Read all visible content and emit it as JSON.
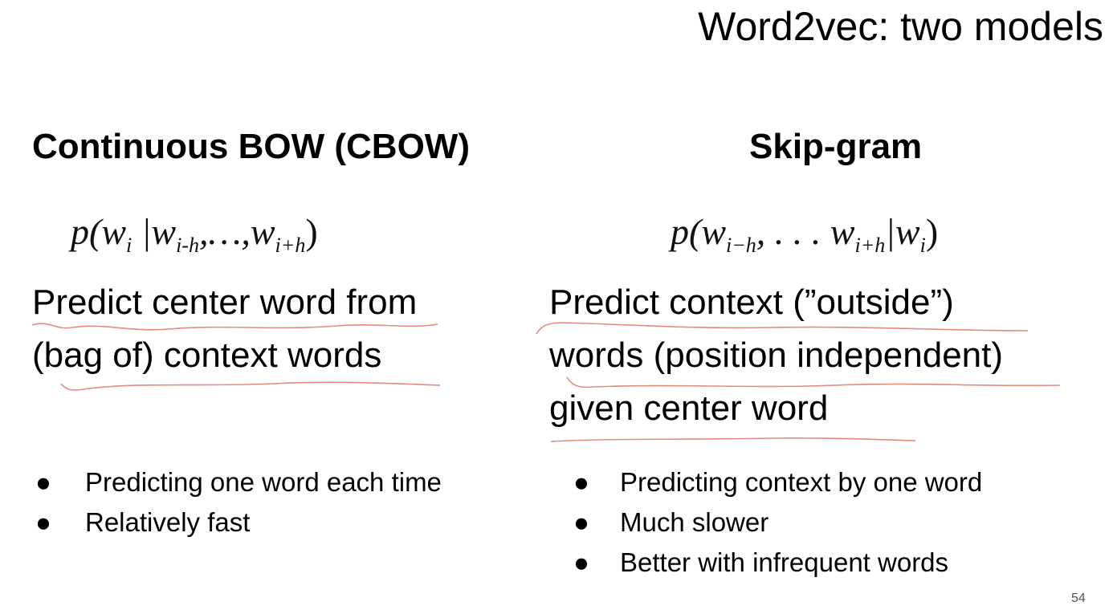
{
  "slide": {
    "title": "Word2vec: two models",
    "page_number": "54"
  },
  "left": {
    "heading": "Continuous BOW (CBOW)",
    "formula": {
      "open": "p(w",
      "sub1": "i",
      "bar": " |w",
      "sub2": "i-h",
      "mid": ",…,w",
      "sub3": "i+h",
      "close": ")"
    },
    "description_lines": [
      "Predict center word from",
      "(bag of) context words"
    ],
    "bullets": [
      "Predicting one word each time",
      "Relatively fast"
    ]
  },
  "right": {
    "heading": "Skip-gram",
    "formula": {
      "open": "p(w",
      "sub1": "i−h",
      "mid": ", . . . w",
      "sub2": "i+h",
      "bar": "|w",
      "sub3": "i",
      "close": ")"
    },
    "description_lines": [
      "Predict context (”outside”)",
      "words (position independent)",
      "given center word"
    ],
    "bullets": [
      "Predicting context by one word",
      "Much slower",
      "Better with infrequent words"
    ]
  },
  "bullet_glyph": "●",
  "annotation_color": "#e58a7c"
}
